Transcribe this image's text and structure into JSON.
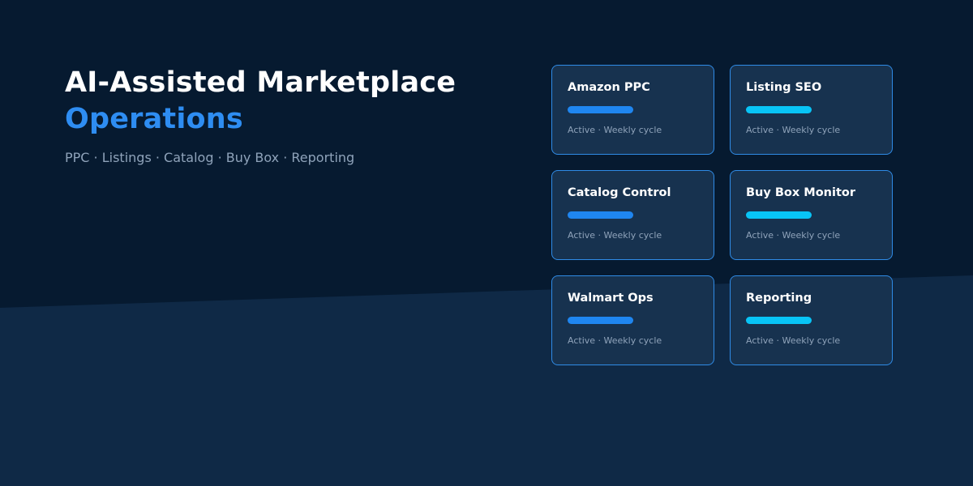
{
  "hero": {
    "title_line1": "AI-Assisted Marketplace",
    "title_line2": "Operations",
    "subtitle": "PPC · Listings · Catalog · Buy Box · Reporting"
  },
  "colors": {
    "accent_blue": "#2e8df2",
    "accent_cyan": "#08c4f6"
  },
  "cards": [
    {
      "title": "Amazon PPC",
      "status": "Active · Weekly cycle",
      "bar_color": "#1f86f0"
    },
    {
      "title": "Listing SEO",
      "status": "Active · Weekly cycle",
      "bar_color": "#08c4f6"
    },
    {
      "title": "Catalog Control",
      "status": "Active · Weekly cycle",
      "bar_color": "#1f86f0"
    },
    {
      "title": "Buy Box Monitor",
      "status": "Active · Weekly cycle",
      "bar_color": "#08c4f6"
    },
    {
      "title": "Walmart Ops",
      "status": "Active · Weekly cycle",
      "bar_color": "#1f86f0"
    },
    {
      "title": "Reporting",
      "status": "Active · Weekly cycle",
      "bar_color": "#08c4f6"
    }
  ]
}
